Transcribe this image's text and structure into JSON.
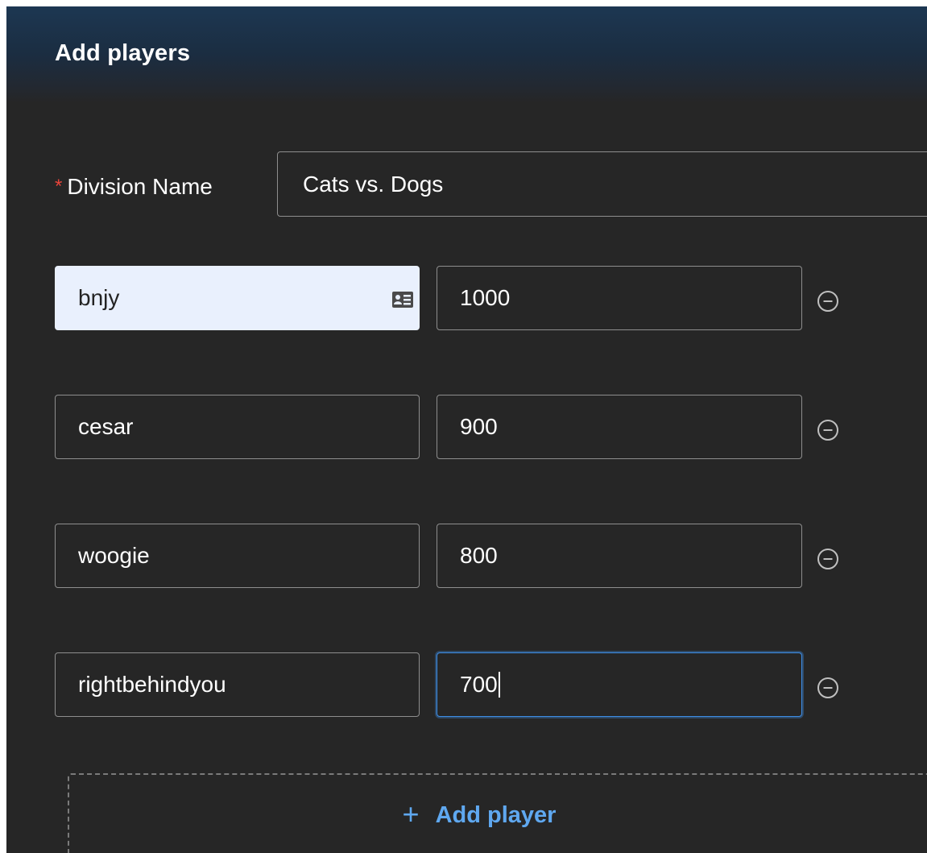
{
  "header": {
    "title": "Add players"
  },
  "division": {
    "required_mark": "*",
    "label": "Division Name",
    "value": "Cats vs. Dogs"
  },
  "players": [
    {
      "name": "bnjy",
      "value": "1000",
      "autofilled": true,
      "focused": false
    },
    {
      "name": "cesar",
      "value": "900",
      "autofilled": false,
      "focused": false
    },
    {
      "name": "woogie",
      "value": "800",
      "autofilled": false,
      "focused": false
    },
    {
      "name": "rightbehindyou",
      "value": "700",
      "autofilled": false,
      "focused": true
    }
  ],
  "add_player": {
    "icon": "plus-icon",
    "label": "Add player"
  },
  "icons": {
    "autofill": "contact-card-icon",
    "remove": "minus-circle-icon"
  },
  "colors": {
    "panel_bg": "#262626",
    "header_top": "#1c3752",
    "required": "#e8443a",
    "accent": "#5fa8f0",
    "focus_border": "#3e8ee6",
    "autofill_bg": "#e9f0fd"
  }
}
